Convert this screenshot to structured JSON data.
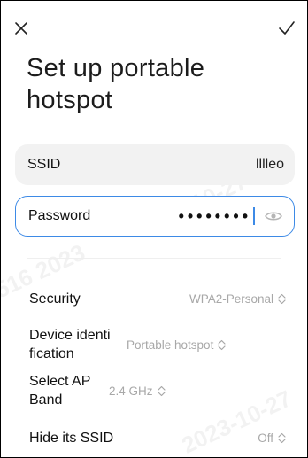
{
  "header": {
    "close_icon": "close-icon",
    "done_icon": "check-icon"
  },
  "page": {
    "title": "Set up portable hotspot"
  },
  "ssid": {
    "label": "SSID",
    "value": "lllleo"
  },
  "password": {
    "label": "Password",
    "masked_value": "••••••••",
    "visibility_icon": "eye-icon"
  },
  "settings": [
    {
      "label": "Security",
      "value": "WPA2-Personal"
    },
    {
      "label": "Device identi fication",
      "value": "Portable hotspot"
    },
    {
      "label": "Select AP Band",
      "value": "2.4 GHz"
    },
    {
      "label": "Hide its SSID",
      "value": "Off"
    }
  ],
  "colors": {
    "accent": "#3d8ae6",
    "field_bg": "#f2f2f2",
    "secondary_text": "#a8a8a8"
  }
}
